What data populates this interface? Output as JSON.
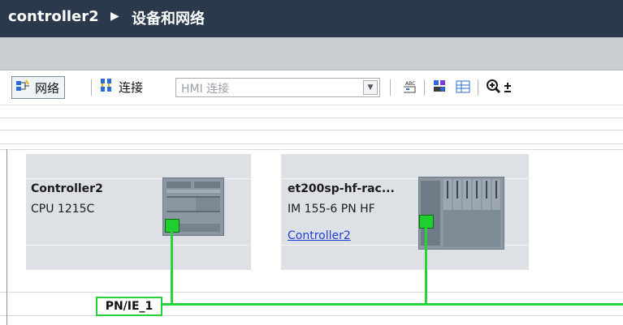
{
  "title": {
    "controller": "controller2",
    "separator": "▶",
    "section": "设备和网络"
  },
  "toolbar": {
    "network_label": "网络",
    "connect_label": "连接",
    "connection_type_value": "HMI 连接",
    "icons": [
      "network-icon",
      "connection-icon",
      "abc-label-icon",
      "device-overview-icon",
      "table-icon",
      "zoom-in-icon"
    ]
  },
  "devices": [
    {
      "name": "Controller2",
      "type": "CPU 1215C"
    },
    {
      "name": "et200sp-hf-rac...",
      "type": "IM 155-6 PN HF",
      "link": "Controller2"
    }
  ],
  "network": {
    "name": "PN/IE_1"
  },
  "colors": {
    "title_bg": "#2a3a4c",
    "device_bg": "#dde1e5",
    "network_line": "#27d33a",
    "link": "#1f3fd6"
  }
}
